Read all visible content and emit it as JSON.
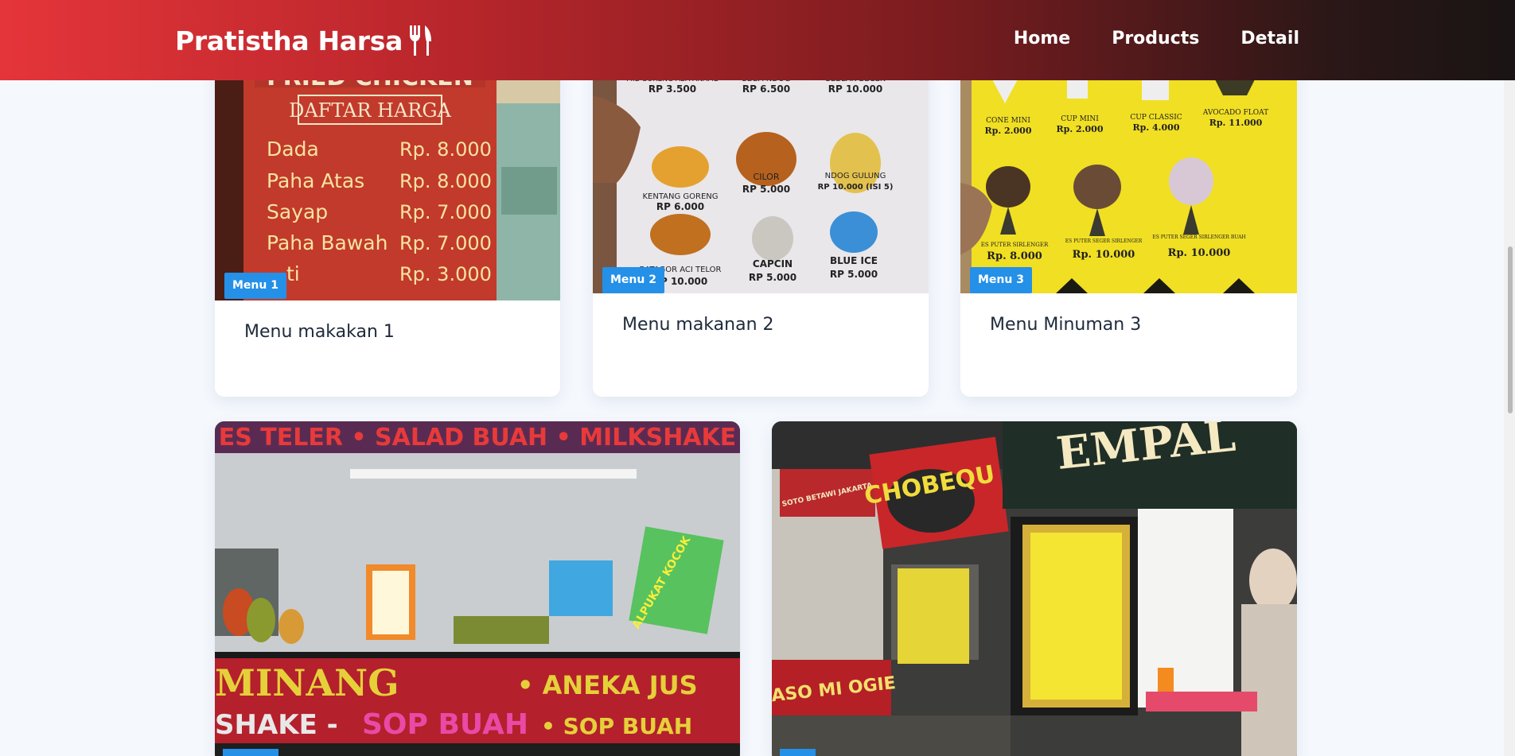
{
  "navbar": {
    "brand": "Pratistha Harsa",
    "brand_icon": "fork-knife-icon",
    "links": [
      {
        "label": "Home"
      },
      {
        "label": "Products"
      },
      {
        "label": "Detail"
      }
    ],
    "gradient": [
      "#e4353a",
      "#1a1414"
    ]
  },
  "cards": [
    {
      "badge": "Menu 1",
      "title": "Menu makakan 1",
      "image_text": {
        "heading": "FRIED CHICKEN",
        "sub": "DAFTAR HARGA",
        "rows": [
          {
            "item": "Dada",
            "price": "Rp. 8.000"
          },
          {
            "item": "Paha Atas",
            "price": "Rp. 8.000"
          },
          {
            "item": "Sayap",
            "price": "Rp. 7.000"
          },
          {
            "item": "Paha Bawah",
            "price": "Rp. 7.000"
          },
          {
            "item": "ti",
            "price": "Rp. 3.000"
          }
        ]
      }
    },
    {
      "badge": "Menu 2",
      "title": "Menu makanan 2",
      "image_text": {
        "items": [
          {
            "name": "MIE GORENG ABA ANAME",
            "price": "RP 3.500"
          },
          {
            "name": "SEGA NDOG",
            "price": "RP 6.500"
          },
          {
            "name": "SEBLAK BECEK",
            "price": "RP 10.000"
          },
          {
            "name": "KENTANG GORENG",
            "price": "RP 6.000"
          },
          {
            "name": "CILOR",
            "price": "RP 5.000"
          },
          {
            "name": "NDOG GULUNG",
            "price": "RP 10.000 (ISI 5)"
          },
          {
            "name": "BATAGOR ACI TELOR",
            "price": "RP 10.000"
          },
          {
            "name": "CAPCIN",
            "price": "RP 5.000"
          },
          {
            "name": "BLUE ICE",
            "price": "RP 5.000"
          }
        ]
      }
    },
    {
      "badge": "Menu 3",
      "title": "Menu Minuman 3",
      "image_text": {
        "items": [
          {
            "name": "CONE MINI",
            "price": "Rp. 2.000"
          },
          {
            "name": "CUP MINI",
            "price": "Rp. 2.000"
          },
          {
            "name": "CUP CLASSIC",
            "price": "Rp. 4.000"
          },
          {
            "name": "AVOCADO FLOAT",
            "price": "Rp. 11.000"
          },
          {
            "name": "ES PUTER SIRLENGER",
            "price": "Rp. 8.000"
          },
          {
            "name": "ES PUTER SEGER SIRLENGER",
            "price": "Rp. 10.000"
          },
          {
            "name": "ES PUTER SEGER SIRLENGER BUAH",
            "price": "Rp. 10.000"
          }
        ]
      }
    },
    {
      "image_text": {
        "banner": "ES TELER • SALAD BUAH • MILKSHAKE",
        "line1_left": "MINANG",
        "line1_right": "• ANEKA JUS",
        "line2_left": "SHAKE -",
        "line2_mid": "SOP BUAH",
        "line2_right": "• SOP BUAH",
        "sign": "ALPUKAT KOCOK"
      }
    },
    {
      "image_text": {
        "sign1": "CHOBEQU",
        "sign2": "BASO MI OGIE",
        "sign3": "EMPAL",
        "sign4": "SOTO BETAWI JAKARTA"
      }
    }
  ],
  "colors": {
    "badge": "#2490e8",
    "title": "#1e2a3b",
    "page_bg": "#f5f8fd"
  }
}
